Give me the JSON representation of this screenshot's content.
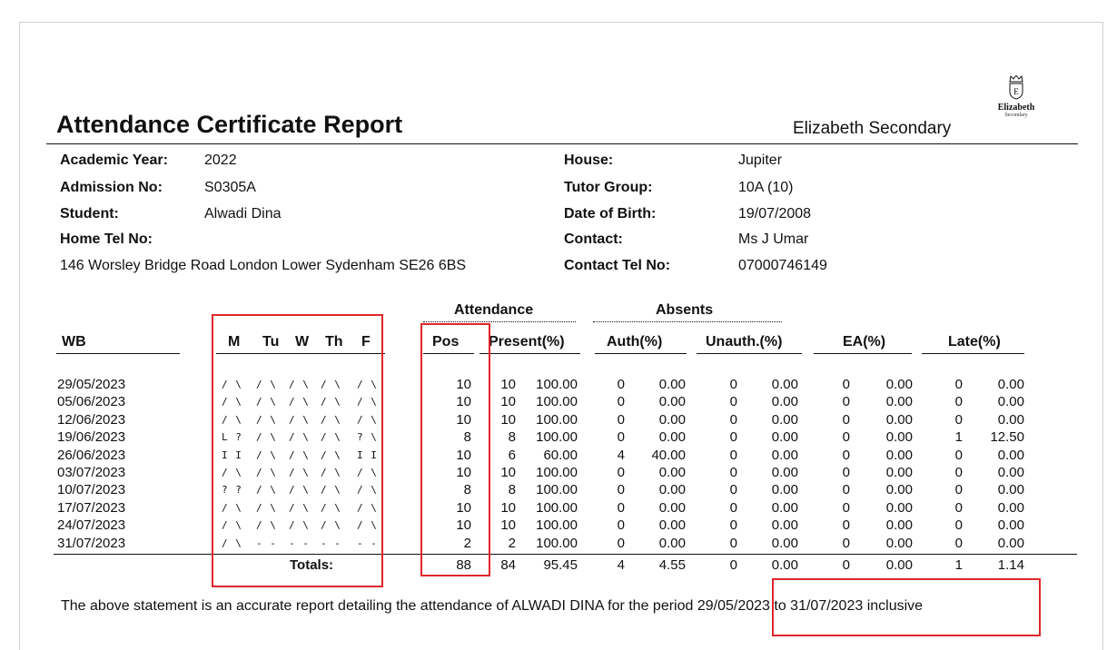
{
  "report": {
    "title": "Attendance Certificate Report",
    "school": "Elizabeth Secondary",
    "logo": {
      "name": "Elizabeth",
      "sub": "Secondary",
      "icon": "crown-shield-icon"
    }
  },
  "student_info": {
    "left": [
      {
        "label": "Academic Year:",
        "value": "2022"
      },
      {
        "label": "Admission No:",
        "value": "S0305A"
      },
      {
        "label": "Student:",
        "value": "Alwadi Dina"
      },
      {
        "label": "Home Tel No:",
        "value": ""
      }
    ],
    "address": "146 Worsley Bridge Road London Lower Sydenham  SE26 6BS",
    "right": [
      {
        "label": "House:",
        "value": "Jupiter"
      },
      {
        "label": "Tutor Group:",
        "value": "10A (10)"
      },
      {
        "label": "Date of Birth:",
        "value": "19/07/2008"
      },
      {
        "label": "Contact:",
        "value": "Ms J Umar"
      },
      {
        "label": "Contact Tel No:",
        "value": "07000746149"
      }
    ]
  },
  "table": {
    "group_headers": {
      "attendance": "Attendance",
      "absents": "Absents"
    },
    "headers": {
      "wb": "WB",
      "days": [
        "M",
        "Tu",
        "W",
        "Th",
        "F"
      ],
      "pos": "Pos",
      "present": "Present(%)",
      "auth": "Auth(%)",
      "unauth": "Unauth.(%)",
      "ea": "EA(%)",
      "late": "Late(%)"
    },
    "rows": [
      {
        "wb": "29/05/2023",
        "marks": [
          "/ \\",
          "/ \\",
          "/ \\",
          "/ \\",
          "/ \\"
        ],
        "pos": "10",
        "present": "10",
        "present_pct": "100.00",
        "auth": "0",
        "auth_pct": "0.00",
        "unauth": "0",
        "unauth_pct": "0.00",
        "ea": "0",
        "ea_pct": "0.00",
        "late": "0",
        "late_pct": "0.00"
      },
      {
        "wb": "05/06/2023",
        "marks": [
          "/ \\",
          "/ \\",
          "/ \\",
          "/ \\",
          "/ \\"
        ],
        "pos": "10",
        "present": "10",
        "present_pct": "100.00",
        "auth": "0",
        "auth_pct": "0.00",
        "unauth": "0",
        "unauth_pct": "0.00",
        "ea": "0",
        "ea_pct": "0.00",
        "late": "0",
        "late_pct": "0.00"
      },
      {
        "wb": "12/06/2023",
        "marks": [
          "/ \\",
          "/ \\",
          "/ \\",
          "/ \\",
          "/ \\"
        ],
        "pos": "10",
        "present": "10",
        "present_pct": "100.00",
        "auth": "0",
        "auth_pct": "0.00",
        "unauth": "0",
        "unauth_pct": "0.00",
        "ea": "0",
        "ea_pct": "0.00",
        "late": "0",
        "late_pct": "0.00"
      },
      {
        "wb": "19/06/2023",
        "marks": [
          "L ?",
          "/ \\",
          "/ \\",
          "/ \\",
          "? \\"
        ],
        "pos": "8",
        "present": "8",
        "present_pct": "100.00",
        "auth": "0",
        "auth_pct": "0.00",
        "unauth": "0",
        "unauth_pct": "0.00",
        "ea": "0",
        "ea_pct": "0.00",
        "late": "1",
        "late_pct": "12.50"
      },
      {
        "wb": "26/06/2023",
        "marks": [
          "I I",
          "/ \\",
          "/ \\",
          "/ \\",
          "I I"
        ],
        "pos": "10",
        "present": "6",
        "present_pct": "60.00",
        "auth": "4",
        "auth_pct": "40.00",
        "unauth": "0",
        "unauth_pct": "0.00",
        "ea": "0",
        "ea_pct": "0.00",
        "late": "0",
        "late_pct": "0.00"
      },
      {
        "wb": "03/07/2023",
        "marks": [
          "/ \\",
          "/ \\",
          "/ \\",
          "/ \\",
          "/ \\"
        ],
        "pos": "10",
        "present": "10",
        "present_pct": "100.00",
        "auth": "0",
        "auth_pct": "0.00",
        "unauth": "0",
        "unauth_pct": "0.00",
        "ea": "0",
        "ea_pct": "0.00",
        "late": "0",
        "late_pct": "0.00"
      },
      {
        "wb": "10/07/2023",
        "marks": [
          "? ?",
          "/ \\",
          "/ \\",
          "/ \\",
          "/ \\"
        ],
        "pos": "8",
        "present": "8",
        "present_pct": "100.00",
        "auth": "0",
        "auth_pct": "0.00",
        "unauth": "0",
        "unauth_pct": "0.00",
        "ea": "0",
        "ea_pct": "0.00",
        "late": "0",
        "late_pct": "0.00"
      },
      {
        "wb": "17/07/2023",
        "marks": [
          "/ \\",
          "/ \\",
          "/ \\",
          "/ \\",
          "/ \\"
        ],
        "pos": "10",
        "present": "10",
        "present_pct": "100.00",
        "auth": "0",
        "auth_pct": "0.00",
        "unauth": "0",
        "unauth_pct": "0.00",
        "ea": "0",
        "ea_pct": "0.00",
        "late": "0",
        "late_pct": "0.00"
      },
      {
        "wb": "24/07/2023",
        "marks": [
          "/ \\",
          "/ \\",
          "/ \\",
          "/ \\",
          "/ \\"
        ],
        "pos": "10",
        "present": "10",
        "present_pct": "100.00",
        "auth": "0",
        "auth_pct": "0.00",
        "unauth": "0",
        "unauth_pct": "0.00",
        "ea": "0",
        "ea_pct": "0.00",
        "late": "0",
        "late_pct": "0.00"
      },
      {
        "wb": "31/07/2023",
        "marks": [
          "/ \\",
          "- -",
          "- -",
          "- -",
          "- -"
        ],
        "pos": "2",
        "present": "2",
        "present_pct": "100.00",
        "auth": "0",
        "auth_pct": "0.00",
        "unauth": "0",
        "unauth_pct": "0.00",
        "ea": "0",
        "ea_pct": "0.00",
        "late": "0",
        "late_pct": "0.00"
      }
    ],
    "totals": {
      "label": "Totals:",
      "pos": "88",
      "present": "84",
      "present_pct": "95.45",
      "auth": "4",
      "auth_pct": "4.55",
      "unauth": "0",
      "unauth_pct": "0.00",
      "ea": "0",
      "ea_pct": "0.00",
      "late": "1",
      "late_pct": "1.14"
    }
  },
  "footer": {
    "statement": "The above statement is an accurate report detailing the attendance of ALWADI DINA for the period",
    "period": "29/05/2023 to 31/07/2023 inclusive"
  },
  "highlight_color": "#e0262a"
}
